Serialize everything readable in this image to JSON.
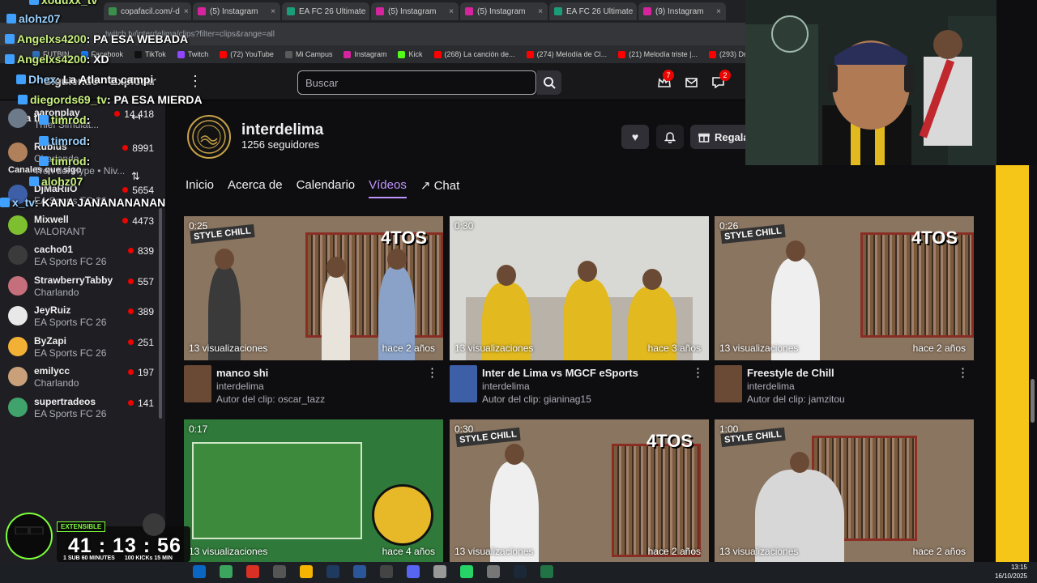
{
  "browser": {
    "tabs": [
      {
        "label": "copafacil.com/-d",
        "color": "#3a8f4a"
      },
      {
        "label": "(5) Instagram",
        "color": "#d6249f"
      },
      {
        "label": "EA FC 26 Ultimate",
        "color": "#1a9e7a"
      },
      {
        "label": "(5) Instagram",
        "color": "#d6249f"
      },
      {
        "label": "(5) Instagram",
        "color": "#d6249f"
      },
      {
        "label": "EA FC 26 Ultimate",
        "color": "#1a9e7a"
      },
      {
        "label": "(9) Instagram",
        "color": "#d6249f"
      }
    ],
    "address": "twitch.tv/interdelima/clips?filter=clips&range=all",
    "bookmarks": [
      {
        "label": "FUTBIN",
        "color": "#2d6fb8"
      },
      {
        "label": "Facebook",
        "color": "#1877f2"
      },
      {
        "label": "TikTok",
        "color": "#111111"
      },
      {
        "label": "Twitch",
        "color": "#9146ff"
      },
      {
        "label": "(72) YouTube",
        "color": "#ff0000"
      },
      {
        "label": "Mi Campus",
        "color": "#5a5a5a"
      },
      {
        "label": "Instagram",
        "color": "#d6249f"
      },
      {
        "label": "Kick",
        "color": "#53fc18"
      },
      {
        "label": "(268) La canción de...",
        "color": "#ff0000"
      },
      {
        "label": "(274) Melodía de Cl...",
        "color": "#ff0000"
      },
      {
        "label": "(21) Melodía triste |...",
        "color": "#ff0000"
      },
      {
        "label": "(293) Dragon Ball E...",
        "color": "#ff0000"
      }
    ]
  },
  "nav": {
    "following": "Siguiendo",
    "browse": "Explorar",
    "search_placeholder": "Buscar",
    "notif_count": "7",
    "whisper_count": "2"
  },
  "sidebar": {
    "title": "Para ti",
    "subtitle": "Canales que sigo",
    "channels": [
      {
        "name": "aaronplay",
        "game": "Thief Simulat...",
        "viewers": "14.418",
        "color": "#6c7a89"
      },
      {
        "name": "Rubius",
        "game": "Charlando",
        "viewers": "8991",
        "extra": "Tren del Hype • Niv...",
        "color": "#b0805a"
      },
      {
        "name": "DjMaRiiO",
        "game": "EA Sports FC 26",
        "viewers": "5654",
        "color": "#3d5fa8"
      },
      {
        "name": "Mixwell",
        "game": "VALORANT",
        "viewers": "4473",
        "color": "#7dbf2f"
      },
      {
        "name": "cacho01",
        "game": "EA Sports FC 26",
        "viewers": "839",
        "color": "#3b3b3b"
      },
      {
        "name": "StrawberryTabby",
        "game": "Charlando",
        "viewers": "557",
        "color": "#c56e7c"
      },
      {
        "name": "JeyRuiz",
        "game": "EA Sports FC 26",
        "viewers": "389",
        "color": "#e8e8e8"
      },
      {
        "name": "ByZapi",
        "game": "EA Sports FC 26",
        "viewers": "251",
        "color": "#f2b134"
      },
      {
        "name": "emilycc",
        "game": "Charlando",
        "viewers": "197",
        "color": "#c9a07a"
      },
      {
        "name": "supertradeos",
        "game": "EA Sports FC 26",
        "viewers": "141",
        "color": "#3fa36b"
      }
    ]
  },
  "chat": [
    {
      "user": "xoduxx_tv",
      "msg": ""
    },
    {
      "user": "alohz07",
      "msg": ""
    },
    {
      "user": "Angelxs4200",
      "msg": ": PA ESA WEBADA"
    },
    {
      "user": "Angelxs4200",
      "msg": ": XD"
    },
    {
      "user": "Dhex",
      "msg": ": La Atlanta campi"
    },
    {
      "user": "diegords69_tv",
      "msg": ": PA ESA MIERDA"
    },
    {
      "user": "timrod",
      "msg": ":"
    },
    {
      "user": "timrod",
      "msg": ":"
    },
    {
      "user": "timrod",
      "msg": ":"
    },
    {
      "user": "alohz07",
      "msg": ""
    },
    {
      "user": "x_tv",
      "msg": ": KANA JANANANANAN"
    }
  ],
  "profile": {
    "name": "interdelima",
    "followers": "1256 seguidores",
    "gift_label": "Regalar",
    "tabs": [
      "Inicio",
      "Acerca de",
      "Calendario",
      "Vídeos",
      "Chat"
    ],
    "active_tab": "Vídeos"
  },
  "clips": [
    {
      "duration": "0:25",
      "views": "13 visualizaciones",
      "age": "hace 2 años",
      "title": "manco shi",
      "channel": "interdelima",
      "author": "Autor del clip: oscar_tazz"
    },
    {
      "duration": "0:30",
      "views": "13 visualizaciones",
      "age": "hace 3 años",
      "title": "Inter de Lima vs MGCF eSports",
      "channel": "interdelima",
      "author": "Autor del clip: gianinag15"
    },
    {
      "duration": "0:26",
      "views": "13 visualizaciones",
      "age": "hace 2 años",
      "title": "Freestyle de Chill",
      "channel": "interdelima",
      "author": "Autor del clip: jamzitou"
    },
    {
      "duration": "0:17",
      "views": "13 visualizaciones",
      "age": "hace 4 años"
    },
    {
      "duration": "0:30",
      "views": "13 visualizaciones",
      "age": "hace 2 años"
    },
    {
      "duration": "1:00",
      "views": "13 visualizaciones",
      "age": "hace 2 años"
    }
  ],
  "overlay": {
    "badge": "EXTENSIBLE",
    "timer": "41 : 13 : 56",
    "sub": "1 SUB",
    "min": "60 MINUTES",
    "kicks": "100 KICKs",
    "kmin": "15 MIN"
  },
  "clock": {
    "time": "13:15",
    "date": "16/10/2025"
  }
}
